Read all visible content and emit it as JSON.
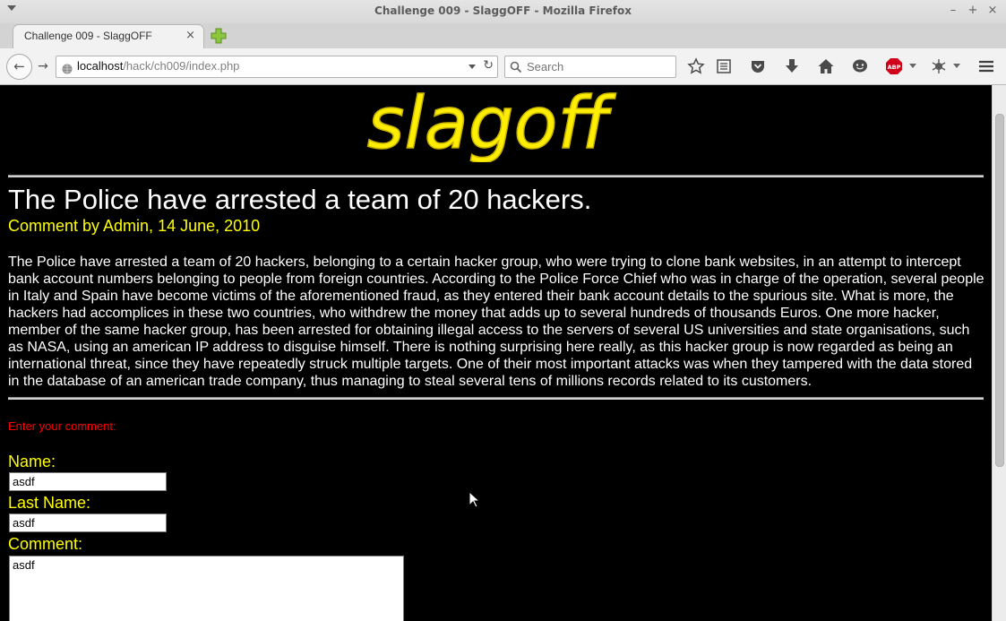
{
  "window": {
    "title": "Challenge 009 - SlaggOFF - Mozilla Firefox",
    "minimize_label": "–",
    "maximize_label": "+",
    "close_label": "×"
  },
  "tabs": [
    {
      "label": "Challenge 009 - SlaggOFF",
      "close_label": "×"
    }
  ],
  "toolbar": {
    "url_host": "localhost",
    "url_path": "/hack/ch009/index.php",
    "search_placeholder": "Search",
    "icons": [
      "star-icon",
      "reading-list-icon",
      "pocket-icon",
      "download-icon",
      "home-icon",
      "chat-icon",
      "adblock-plus-icon",
      "extension-icon",
      "menu-icon"
    ],
    "abp_label": "ABP"
  },
  "page": {
    "logo_text": "slagoff",
    "headline": "The Police have arrested a team of 20 hackers.",
    "byline": "Comment by Admin, 14 June, 2010",
    "article": "The Police have arrested a team of 20 hackers, belonging to a certain hacker group, who were trying to clone bank websites, in an attempt to intercept bank account numbers belonging to people from foreign countries. According to the Police Force Chief who was in charge of the operation, several people in Italy and Spain have become victims of the aforementioned fraud, as they entered their bank account details to the spurious site. What is more, the hackers had accomplices in these two countries, who withdrew the money that adds up to several hundreds of thousands Euros. One more hacker, member of the same hacker group, has been arrested for obtaining illegal access to the servers of several US universities and state organisations, such as NASA, using an american IP address to disguise himself. There is nothing surprising here really, as this hacker group is now regarded as being an international threat, since they have repeatedly struck multiple targets. One of their most important attacks was when they tampered with the data stored in the database of an american trade company, thus managing to steal several tens of millions records related to its customers.",
    "form": {
      "prompt": "Enter your comment:",
      "name_label": "Name:",
      "name_value": "asdf",
      "lastname_label": "Last Name:",
      "lastname_value": "asdf",
      "comment_label": "Comment:",
      "comment_value": "asdf"
    }
  },
  "colors": {
    "page_background": "#000000",
    "headline": "#ffffff",
    "accent_yellow": "#ffff00",
    "prompt_red": "#ff0000"
  }
}
